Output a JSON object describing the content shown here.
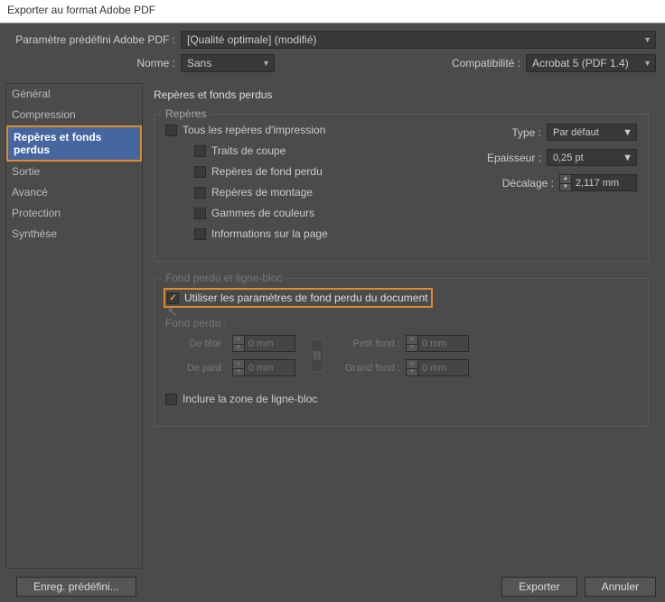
{
  "title": "Exporter au format Adobe PDF",
  "preset": {
    "label": "Paramètre prédéfini Adobe PDF :",
    "value": "[Qualité optimale] (modifié)"
  },
  "standard": {
    "label": "Norme :",
    "value": "Sans"
  },
  "compat": {
    "label": "Compatibilité :",
    "value": "Acrobat 5 (PDF 1.4)"
  },
  "sidebar": {
    "items": [
      {
        "label": "Général"
      },
      {
        "label": "Compression"
      },
      {
        "label": "Repères et fonds perdus"
      },
      {
        "label": "Sortie"
      },
      {
        "label": "Avancé"
      },
      {
        "label": "Protection"
      },
      {
        "label": "Synthèse"
      }
    ],
    "selected": 2
  },
  "content_title": "Repères et fonds perdus",
  "marks": {
    "legend": "Repères",
    "all": "Tous les repères d'impression",
    "crop": "Traits de coupe",
    "bleed": "Repères de fond perdu",
    "reg": "Repères de montage",
    "color": "Gammes de couleurs",
    "page": "Informations sur la page",
    "type_label": "Type :",
    "type_value": "Par défaut",
    "weight_label": "Epaisseur :",
    "weight_value": "0,25 pt",
    "offset_label": "Décalage :",
    "offset_value": "2,117 mm"
  },
  "bleed": {
    "legend": "Fond perdu et ligne-bloc",
    "use_doc": "Utiliser les paramètres de fond perdu du document",
    "section_label": "Fond perdu :",
    "top_label": "De tête :",
    "bottom_label": "De pied :",
    "inside_label": "Petit fond :",
    "outside_label": "Grand fond :",
    "value": "0 mm",
    "include_slug": "Inclure la zone de ligne-bloc"
  },
  "footer": {
    "save_preset": "Enreg. prédéfini...",
    "export": "Exporter",
    "cancel": "Annuler"
  }
}
